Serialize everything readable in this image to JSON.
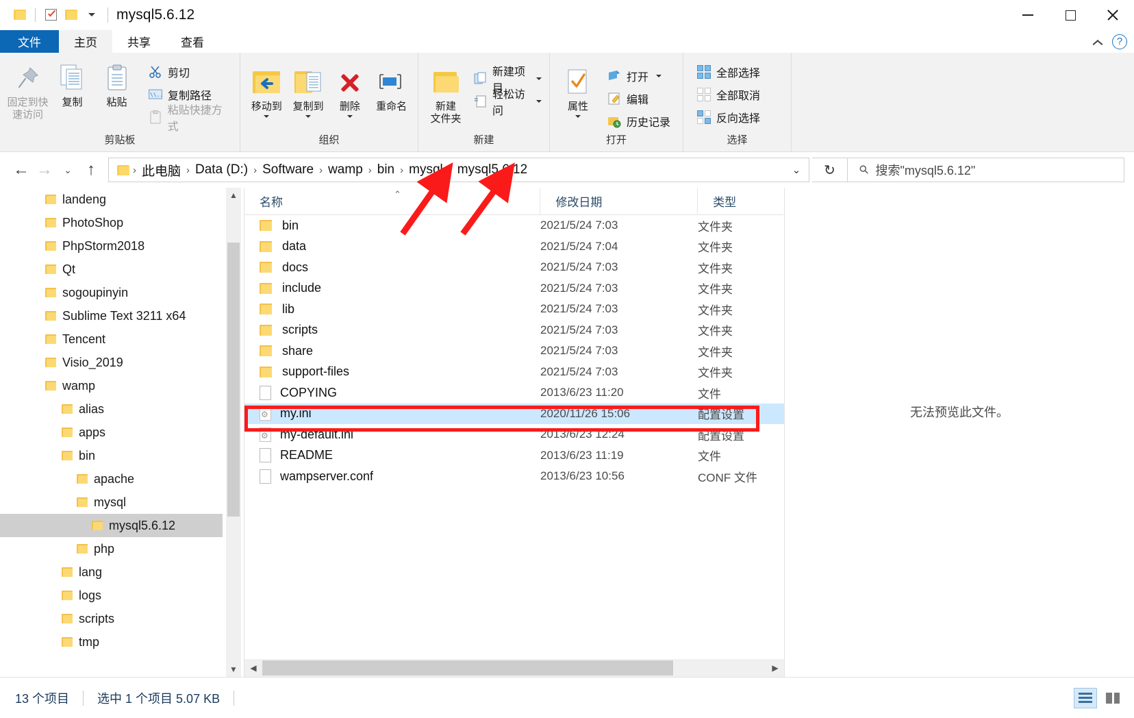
{
  "window": {
    "title": "mysql5.6.12",
    "minimize_label": "─",
    "maximize_label": "□",
    "close_label": "✕"
  },
  "quick_access": {
    "folder_icon": "folder-icon",
    "properties_icon": "properties-check-icon",
    "new_folder_icon": "new-folder-icon",
    "customize_caret": "chevron-down-icon"
  },
  "ribbon": {
    "tabs": [
      {
        "label": "文件",
        "name": "tab-file"
      },
      {
        "label": "主页",
        "name": "tab-home"
      },
      {
        "label": "共享",
        "name": "tab-share"
      },
      {
        "label": "查看",
        "name": "tab-view"
      }
    ],
    "collapse_icon": "chevron-up-icon",
    "help_icon": "?",
    "groups": [
      {
        "name": "clipboard",
        "label": "剪贴板",
        "big_buttons": [
          {
            "label": "固定到快\n速访问",
            "line1": "固定到快",
            "line2": "速访问",
            "icon": "pin-icon"
          },
          {
            "label": "复制",
            "line1": "复制",
            "line2": "",
            "icon": "copy-icon"
          },
          {
            "label": "粘贴",
            "line1": "粘贴",
            "line2": "",
            "icon": "paste-icon"
          }
        ],
        "small_buttons": [
          {
            "label": "剪切",
            "icon": "scissors-icon",
            "disabled": false
          },
          {
            "label": "复制路径",
            "icon": "copy-path-icon",
            "disabled": false
          },
          {
            "label": "粘贴快捷方式",
            "icon": "paste-shortcut-icon",
            "disabled": true
          }
        ]
      },
      {
        "name": "organize",
        "label": "组织",
        "big_buttons": [
          {
            "line1": "移动到",
            "line2": "",
            "icon": "move-to-icon",
            "caret": true
          },
          {
            "line1": "复制到",
            "line2": "",
            "icon": "copy-to-icon",
            "caret": true
          },
          {
            "line1": "删除",
            "line2": "",
            "icon": "delete-icon",
            "caret": true
          },
          {
            "line1": "重命名",
            "line2": "",
            "icon": "rename-icon",
            "caret": false
          }
        ]
      },
      {
        "name": "new",
        "label": "新建",
        "big_buttons": [
          {
            "line1": "新建",
            "line2": "文件夹",
            "icon": "new-folder-icon",
            "caret": false
          }
        ],
        "small_buttons": [
          {
            "label": "新建项目",
            "icon": "new-item-icon",
            "caret": true
          },
          {
            "label": "轻松访问",
            "icon": "easy-access-icon",
            "caret": true
          }
        ]
      },
      {
        "name": "open",
        "label": "打开",
        "big_buttons": [
          {
            "line1": "属性",
            "line2": "",
            "icon": "properties-icon",
            "caret": true
          }
        ],
        "small_buttons": [
          {
            "label": "打开",
            "icon": "open-icon",
            "caret": true
          },
          {
            "label": "编辑",
            "icon": "edit-icon",
            "caret": false
          },
          {
            "label": "历史记录",
            "icon": "history-icon",
            "caret": false
          }
        ]
      },
      {
        "name": "select",
        "label": "选择",
        "small_buttons": [
          {
            "label": "全部选择",
            "icon": "select-all-icon"
          },
          {
            "label": "全部取消",
            "icon": "select-none-icon"
          },
          {
            "label": "反向选择",
            "icon": "invert-selection-icon"
          }
        ]
      }
    ]
  },
  "nav": {
    "back_icon": "←",
    "forward_icon": "→",
    "recent_icon": "⌄",
    "up_icon": "↑",
    "address_dropdown_icon": "⌄",
    "refresh_icon": "↻",
    "breadcrumbs": [
      "此电脑",
      "Data (D:)",
      "Software",
      "wamp",
      "bin",
      "mysql",
      "mysql5.6.12"
    ],
    "separator": "›"
  },
  "search": {
    "placeholder": "搜索\"mysql5.6.12\"",
    "icon": "search-icon"
  },
  "tree": {
    "items": [
      {
        "label": "landeng",
        "indent": 1
      },
      {
        "label": "PhotoShop",
        "indent": 1
      },
      {
        "label": "PhpStorm2018",
        "indent": 1
      },
      {
        "label": "Qt",
        "indent": 1
      },
      {
        "label": "sogoupinyin",
        "indent": 1
      },
      {
        "label": "Sublime Text 3211 x64",
        "indent": 1
      },
      {
        "label": "Tencent",
        "indent": 1
      },
      {
        "label": "Visio_2019",
        "indent": 1
      },
      {
        "label": "wamp",
        "indent": 1
      },
      {
        "label": "alias",
        "indent": 2
      },
      {
        "label": "apps",
        "indent": 2
      },
      {
        "label": "bin",
        "indent": 2
      },
      {
        "label": "apache",
        "indent": 3
      },
      {
        "label": "mysql",
        "indent": 3
      },
      {
        "label": "mysql5.6.12",
        "indent": 4,
        "selected": true
      },
      {
        "label": "php",
        "indent": 3
      },
      {
        "label": "lang",
        "indent": 2
      },
      {
        "label": "logs",
        "indent": 2
      },
      {
        "label": "scripts",
        "indent": 2
      },
      {
        "label": "tmp",
        "indent": 2
      }
    ]
  },
  "filelist": {
    "columns": [
      {
        "label": "名称",
        "name": "column-name"
      },
      {
        "label": "修改日期",
        "name": "column-date-modified"
      },
      {
        "label": "类型",
        "name": "column-type"
      }
    ],
    "sort_indicator": "⌃",
    "rows": [
      {
        "name": "bin",
        "date": "2021/5/24 7:03",
        "type": "文件夹",
        "icon": "folder"
      },
      {
        "name": "data",
        "date": "2021/5/24 7:04",
        "type": "文件夹",
        "icon": "folder"
      },
      {
        "name": "docs",
        "date": "2021/5/24 7:03",
        "type": "文件夹",
        "icon": "folder"
      },
      {
        "name": "include",
        "date": "2021/5/24 7:03",
        "type": "文件夹",
        "icon": "folder"
      },
      {
        "name": "lib",
        "date": "2021/5/24 7:03",
        "type": "文件夹",
        "icon": "folder"
      },
      {
        "name": "scripts",
        "date": "2021/5/24 7:03",
        "type": "文件夹",
        "icon": "folder"
      },
      {
        "name": "share",
        "date": "2021/5/24 7:03",
        "type": "文件夹",
        "icon": "folder"
      },
      {
        "name": "support-files",
        "date": "2021/5/24 7:03",
        "type": "文件夹",
        "icon": "folder"
      },
      {
        "name": "COPYING",
        "date": "2013/6/23 11:20",
        "type": "文件",
        "icon": "file"
      },
      {
        "name": "my.ini",
        "date": "2020/11/26 15:06",
        "type": "配置设置",
        "icon": "gear",
        "selected": true
      },
      {
        "name": "my-default.ini",
        "date": "2013/6/23 12:24",
        "type": "配置设置",
        "icon": "gear"
      },
      {
        "name": "README",
        "date": "2013/6/23 11:19",
        "type": "文件",
        "icon": "file"
      },
      {
        "name": "wampserver.conf",
        "date": "2013/6/23 10:56",
        "type": "CONF 文件",
        "icon": "file"
      }
    ]
  },
  "preview": {
    "message": "无法预览此文件。"
  },
  "statusbar": {
    "item_count": "13 个项目",
    "selection": "选中 1 个项目  5.07 KB",
    "view_details_icon": "details-view-icon",
    "view_large_icon": "large-icons-view-icon"
  },
  "annotations": {
    "highlight_color": "#fb1a1a",
    "selected_row_color": "#cce8ff",
    "arrow_count": 2
  }
}
